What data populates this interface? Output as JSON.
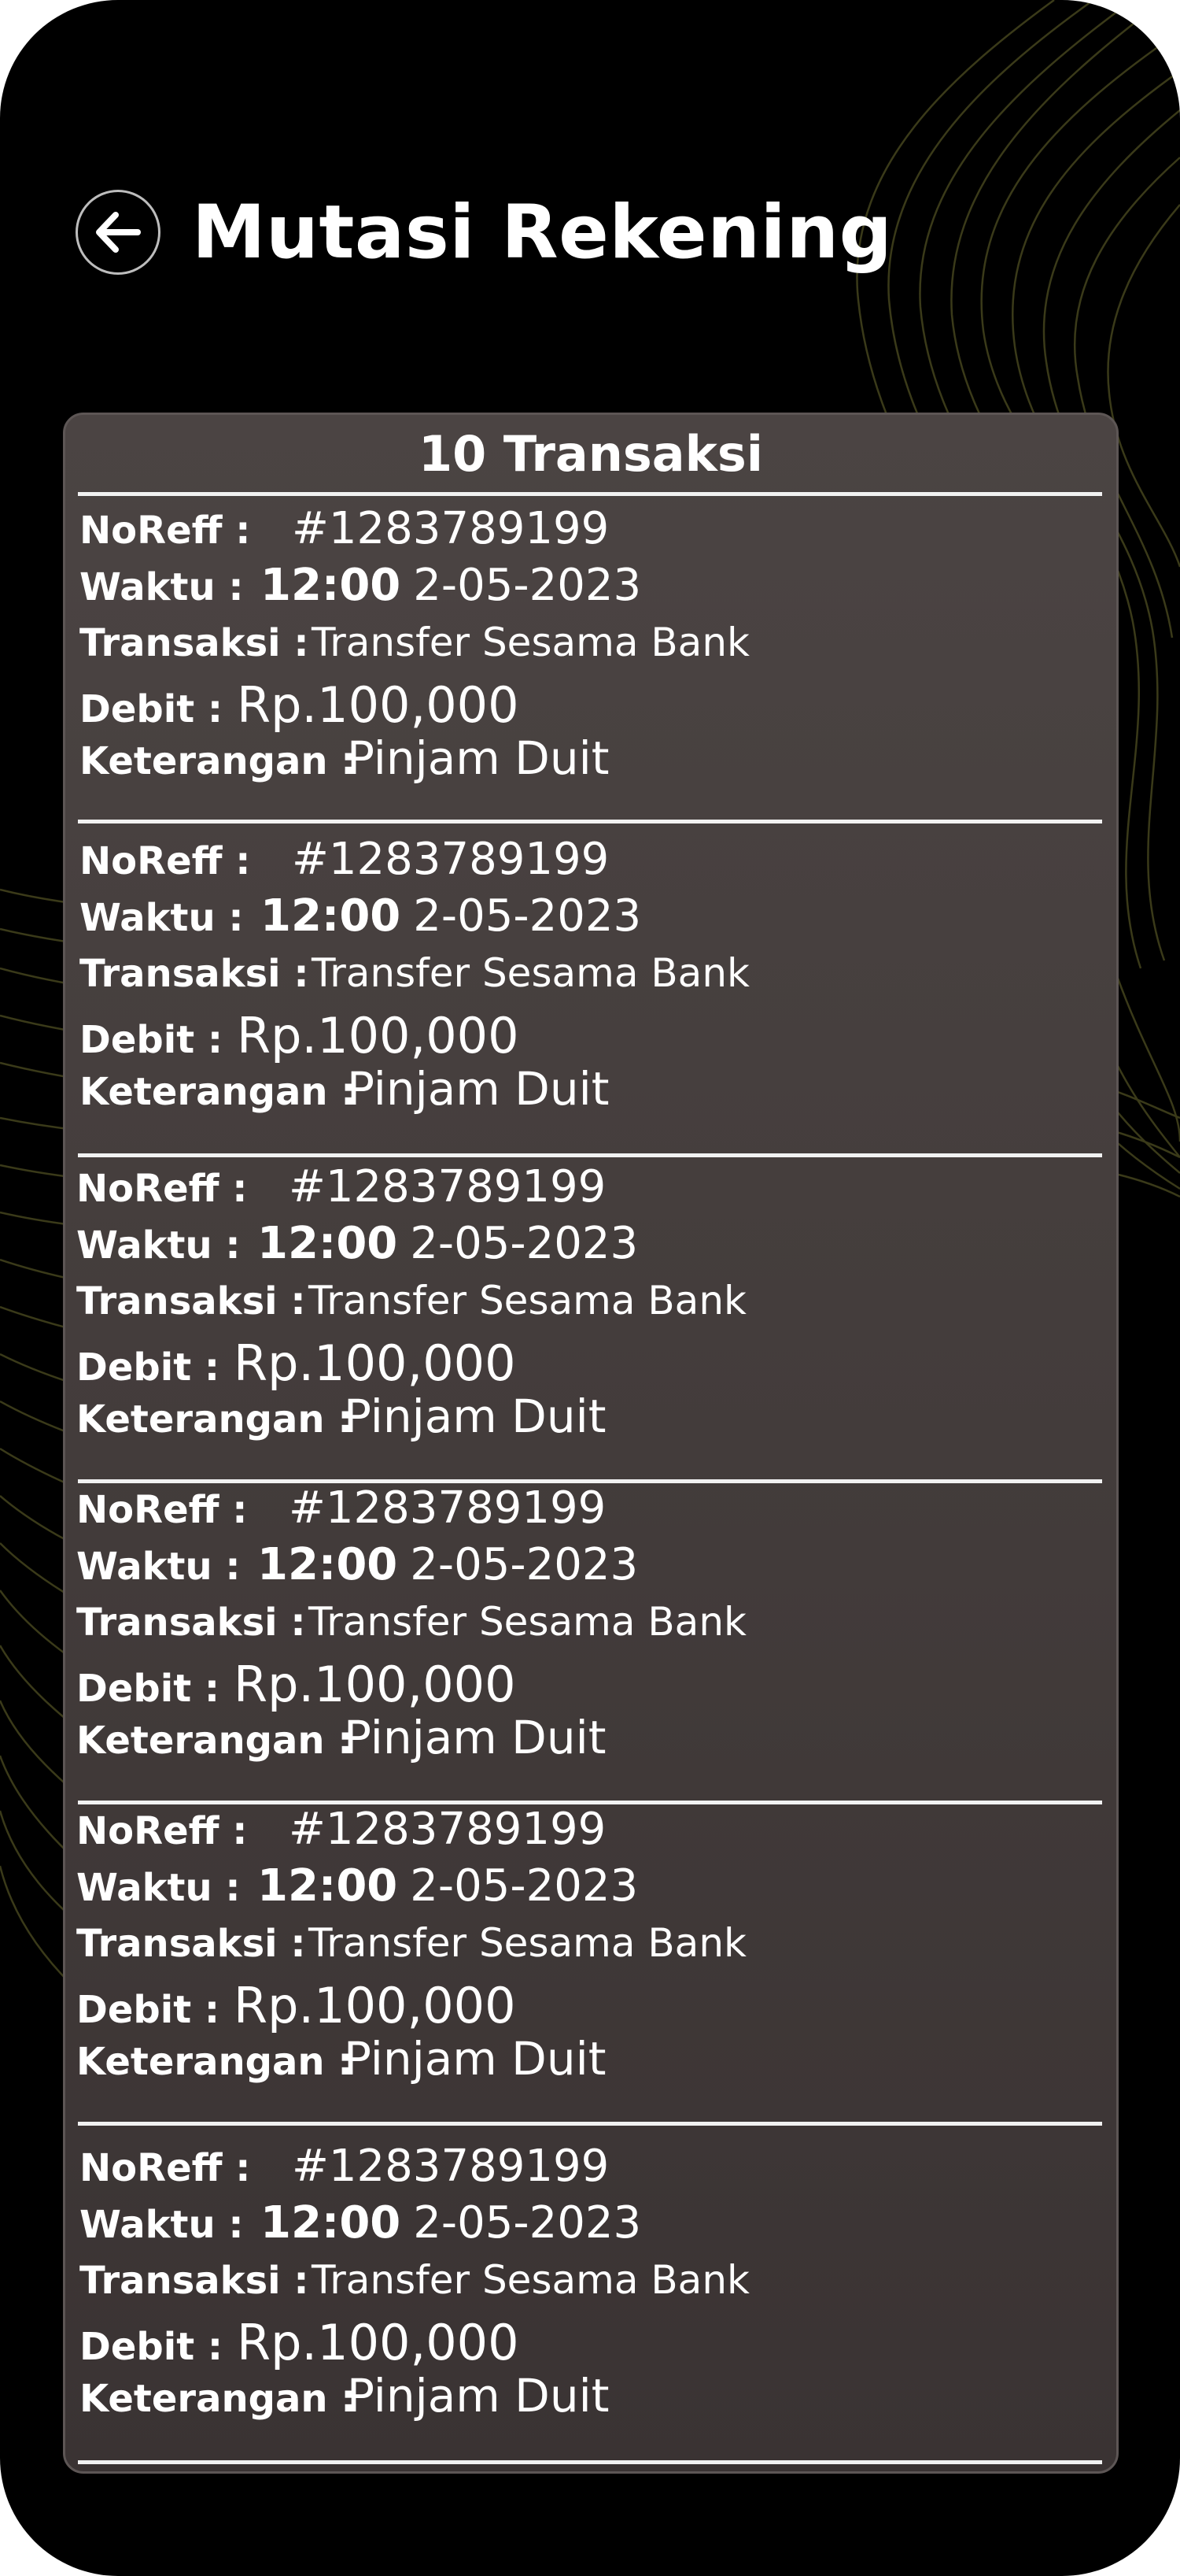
{
  "header": {
    "title": "Mutasi Rekening",
    "back_icon": "arrow-left-icon"
  },
  "summary": {
    "title": "10 Transaksi"
  },
  "labels": {
    "noreff": "NoReff :",
    "waktu": "Waktu :",
    "transaksi": "Transaksi :",
    "debit": "Debit :",
    "keterangan": "Keterangan :"
  },
  "transactions": [
    {
      "noreff": "#1283789199",
      "time": "12:00",
      "date": "2-05-2023",
      "type": "Transfer Sesama Bank",
      "debit": "Rp.100,000",
      "note": "Pinjam Duit"
    },
    {
      "noreff": "#1283789199",
      "time": "12:00",
      "date": "2-05-2023",
      "type": "Transfer Sesama Bank",
      "debit": "Rp.100,000",
      "note": "Pinjam Duit"
    },
    {
      "noreff": "#1283789199",
      "time": "12:00",
      "date": "2-05-2023",
      "type": "Transfer Sesama Bank",
      "debit": "Rp.100,000",
      "note": "Pinjam Duit"
    },
    {
      "noreff": "#1283789199",
      "time": "12:00",
      "date": "2-05-2023",
      "type": "Transfer Sesama Bank",
      "debit": "Rp.100,000",
      "note": "Pinjam Duit"
    },
    {
      "noreff": "#1283789199",
      "time": "12:00",
      "date": "2-05-2023",
      "type": "Transfer Sesama Bank",
      "debit": "Rp.100,000",
      "note": "Pinjam Duit"
    },
    {
      "noreff": "#1283789199",
      "time": "12:00",
      "date": "2-05-2023",
      "type": "Transfer Sesama Bank",
      "debit": "Rp.100,000",
      "note": "Pinjam Duit"
    }
  ],
  "colors": {
    "background": "#000000",
    "card": "#443d3c",
    "text": "#ffffff",
    "decor_lines": "#6b6a2e"
  }
}
